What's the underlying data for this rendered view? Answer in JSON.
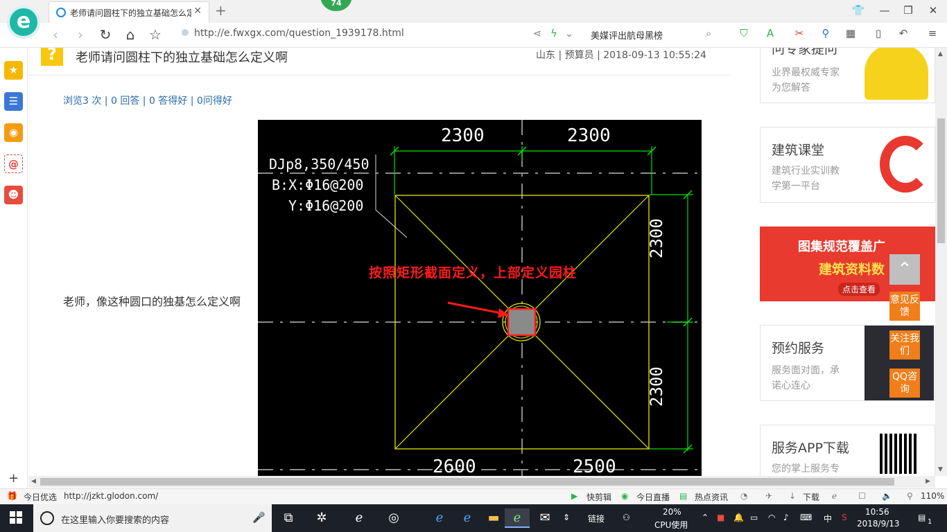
{
  "browser": {
    "tab_title": "老师请问圆柱下的独立基础怎么定义",
    "update_badge": "74",
    "url": "http://e.fwxgx.com/question_1939178.html",
    "search_text": "美媒评出航母黑榜"
  },
  "question": {
    "title": "老师请问圆柱下的独立基础怎么定义啊",
    "meta": "山东 | 预算员 | 2018-09-13 10:55:24",
    "stats": "浏览3 次 | 0 回答 | 0 答得好 | 0问得好",
    "body": "老师，像这种圆口的独基怎么定义啊"
  },
  "drawing": {
    "dim_top_left": "2300",
    "dim_top_right": "2300",
    "dim_right_top": "2300",
    "dim_right_bottom": "2300",
    "dim_bottom_left": "2600",
    "dim_bottom_right": "2500",
    "label_line1": "DJp8,350/450",
    "label_line2": "B:X:Φ16@200",
    "label_line3": "Y:Φ16@200",
    "annotation": "按照矩形截面定义，上部定义园柱"
  },
  "ads": [
    {
      "title": "问专家提问",
      "line1": "业界最权威专家",
      "line2": "为您解答"
    },
    {
      "title": "建筑课堂",
      "line1": "建筑行业实训教",
      "line2": "学第一平台"
    },
    {
      "title": "图集规范覆盖广",
      "line1": "建筑资料数",
      "line2": "点击查看"
    },
    {
      "title": "预约服务",
      "line1": "服务面对面，承",
      "line2": "诺心连心"
    },
    {
      "title": "服务APP下载",
      "line1": "您的掌上服务专",
      "line2": ""
    }
  ],
  "float_buttons": {
    "feedback": "意见反馈",
    "follow": "关注我们",
    "qq": "QQ咨询"
  },
  "statusbar": {
    "left_label": "今日优选",
    "hover_url": "http://jzkt.glodon.com/",
    "items": [
      "快剪辑",
      "今日直播",
      "热点资讯",
      "下载"
    ],
    "zoom": "110%"
  },
  "taskbar": {
    "search_placeholder": "在这里输入你要搜索的内容",
    "link_label": "链接",
    "cpu_percent": "20%",
    "cpu_label": "CPU使用",
    "ime": "中",
    "time": "10:56",
    "date": "2018/9/13",
    "notification_count": "1"
  },
  "colors": {
    "accent": "#1fb8a8",
    "link": "#2a6aa8",
    "orange": "#f07e1a",
    "cad_yellow": "#e6e600",
    "cad_green": "#00e000",
    "cad_red": "#ff1a1a"
  }
}
